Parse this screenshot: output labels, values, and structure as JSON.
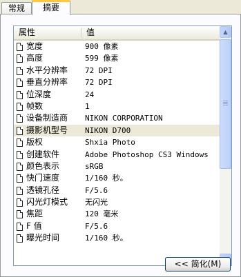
{
  "tabs": [
    {
      "label": "常规"
    },
    {
      "label": "摘要"
    }
  ],
  "columns": {
    "property": "属性",
    "value": "值"
  },
  "rows": [
    {
      "name": "宽度",
      "value": "900 像素"
    },
    {
      "name": "高度",
      "value": "599 像素"
    },
    {
      "name": "水平分辨率",
      "value": "72 DPI"
    },
    {
      "name": "垂直分辨率",
      "value": "72 DPI"
    },
    {
      "name": "位深度",
      "value": "24"
    },
    {
      "name": "帧数",
      "value": "1"
    },
    {
      "name": "设备制造商",
      "value": "NIKON CORPORATION"
    },
    {
      "name": "摄影机型号",
      "value": "NIKON D700"
    },
    {
      "name": "版权",
      "value": "Shxia Photo"
    },
    {
      "name": "创建软件",
      "value": "Adobe Photoshop CS3 Windows"
    },
    {
      "name": "颜色表示",
      "value": "sRGB"
    },
    {
      "name": "快门速度",
      "value": "1/160 秒。"
    },
    {
      "name": "透镜孔径",
      "value": "F/5.6"
    },
    {
      "name": "闪光灯模式",
      "value": "无闪光"
    },
    {
      "name": "焦距",
      "value": "120 毫米"
    },
    {
      "name": "F 值",
      "value": "F/5.6"
    },
    {
      "name": "曝光时间",
      "value": "1/160 秒。"
    }
  ],
  "selected_row": "摄影机型号",
  "button": {
    "label": "<< 简化(M)"
  },
  "scrollbar": {
    "up_glyph": "▲",
    "down_glyph": "▼"
  }
}
